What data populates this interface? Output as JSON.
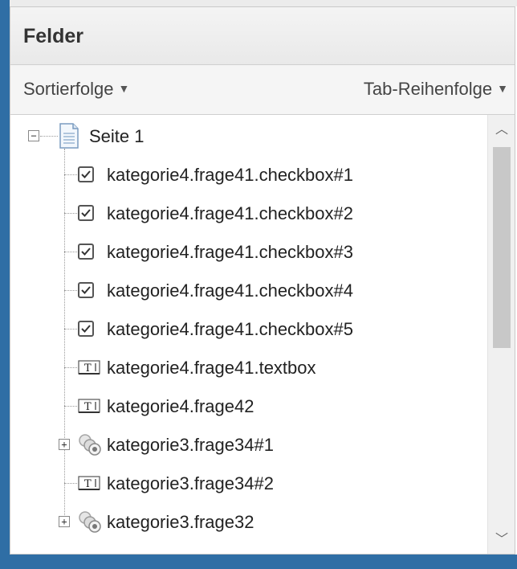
{
  "panel": {
    "title": "Felder"
  },
  "sort_bar": {
    "sort_label": "Sortierfolge",
    "tab_label": "Tab-Reihenfolge"
  },
  "tree": {
    "root": {
      "label": "Seite 1",
      "expanded": true,
      "icon": "page-icon"
    },
    "items": [
      {
        "label": "kategorie4.frage41.checkbox#1",
        "icon": "checkbox-icon"
      },
      {
        "label": "kategorie4.frage41.checkbox#2",
        "icon": "checkbox-icon"
      },
      {
        "label": "kategorie4.frage41.checkbox#3",
        "icon": "checkbox-icon"
      },
      {
        "label": "kategorie4.frage41.checkbox#4",
        "icon": "checkbox-icon"
      },
      {
        "label": "kategorie4.frage41.checkbox#5",
        "icon": "checkbox-icon"
      },
      {
        "label": "kategorie4.frage41.textbox",
        "icon": "textfield-icon"
      },
      {
        "label": "kategorie4.frage42",
        "icon": "textfield-icon"
      },
      {
        "label": "kategorie3.frage34#1",
        "icon": "radio-group-icon",
        "collapsed": true
      },
      {
        "label": "kategorie3.frage34#2",
        "icon": "textfield-icon"
      },
      {
        "label": "kategorie3.frage32",
        "icon": "radio-group-icon",
        "collapsed": true
      }
    ]
  },
  "colors": {
    "accent": "#2f6ea5",
    "header_bg": "#ececec",
    "scroll_thumb": "#c8c8c8"
  }
}
